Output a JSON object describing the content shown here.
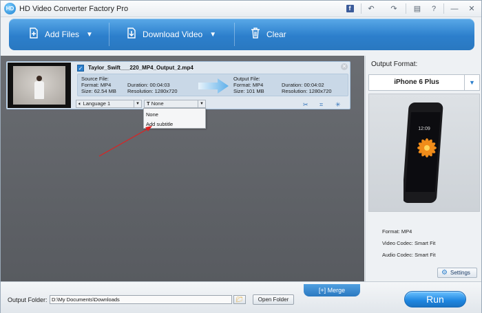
{
  "window": {
    "title": "HD Video Converter Factory Pro",
    "logo_text": "HD"
  },
  "titlebar_buttons": {
    "facebook": "f",
    "undo": "↶",
    "redo": "↷",
    "chat": "▤",
    "help": "?",
    "minimize": "—",
    "close": "✕"
  },
  "toolbar": {
    "add_files_label": "Add Files",
    "download_video_label": "Download Video",
    "clear_label": "Clear"
  },
  "file_item": {
    "checked": true,
    "filename": "Taylor_Swift___220_MP4_Output_2.mp4",
    "source": {
      "heading": "Source File:",
      "format": "Format: MP4",
      "duration": "Duration: 00:04:03",
      "size": "Size: 62.54 MB",
      "resolution": "Resolution: 1280x720"
    },
    "output": {
      "heading": "Output File:",
      "format": "Format: MP4",
      "duration": "Duration: 00:04:02",
      "size": "Size: 101 MB",
      "resolution": "Resolution: 1280x720"
    },
    "audio_track": "Language 1",
    "subtitle": "None"
  },
  "subtitle_dropdown": {
    "options": [
      "None",
      "Add subtitle"
    ]
  },
  "right_panel": {
    "output_format_label": "Output Format:",
    "device": "iPhone 6 Plus",
    "specs": {
      "format": "Format: MP4",
      "video_codec": "Video Codec: Smart Fit",
      "audio_codec": "Audio Codec: Smart Fit"
    },
    "settings_label": "Settings"
  },
  "bottom": {
    "merge_label": "Merge",
    "output_folder_label": "Output Folder:",
    "output_folder_path": "D:\\My Documents\\Downloads",
    "open_folder_label": "Open Folder",
    "run_label": "Run"
  },
  "colors": {
    "accent": "#2c7fcc",
    "panel_dark": "#5f6267",
    "annotation_arrow": "#e02020"
  }
}
